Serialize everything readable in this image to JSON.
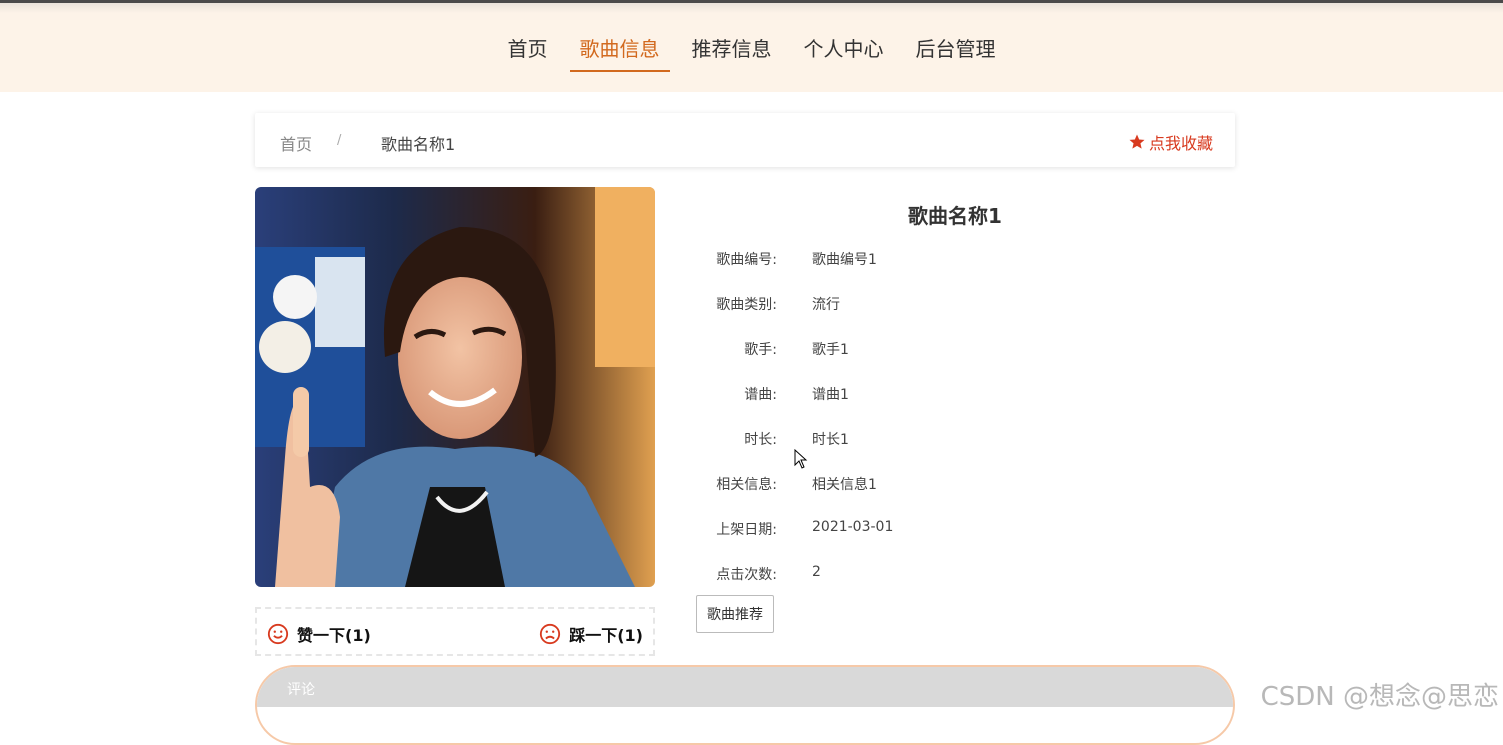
{
  "nav": {
    "items": [
      "首页",
      "歌曲信息",
      "推荐信息",
      "个人中心",
      "后台管理"
    ],
    "active_index": 1
  },
  "breadcrumb": {
    "home": "首页",
    "separator": "/",
    "current": "歌曲名称1"
  },
  "favorite": {
    "label": "点我收藏",
    "color": "#d83a1f"
  },
  "votes": {
    "up_label": "赞一下(1)",
    "down_label": "踩一下(1)"
  },
  "song": {
    "title": "歌曲名称1",
    "fields": [
      {
        "label": "歌曲编号:",
        "value": "歌曲编号1"
      },
      {
        "label": "歌曲类别:",
        "value": "流行"
      },
      {
        "label": "歌手:",
        "value": "歌手1"
      },
      {
        "label": "谱曲:",
        "value": "谱曲1"
      },
      {
        "label": "时长:",
        "value": "时长1"
      },
      {
        "label": "相关信息:",
        "value": "相关信息1"
      },
      {
        "label": "上架日期:",
        "value": "2021-03-01"
      },
      {
        "label": "点击次数:",
        "value": "2"
      }
    ]
  },
  "recommend_button": "歌曲推荐",
  "comment": {
    "label": "评论"
  },
  "watermark": "CSDN @想念@思恋",
  "colors": {
    "accent": "#d2691e",
    "header_bg": "#fdf3e8"
  }
}
